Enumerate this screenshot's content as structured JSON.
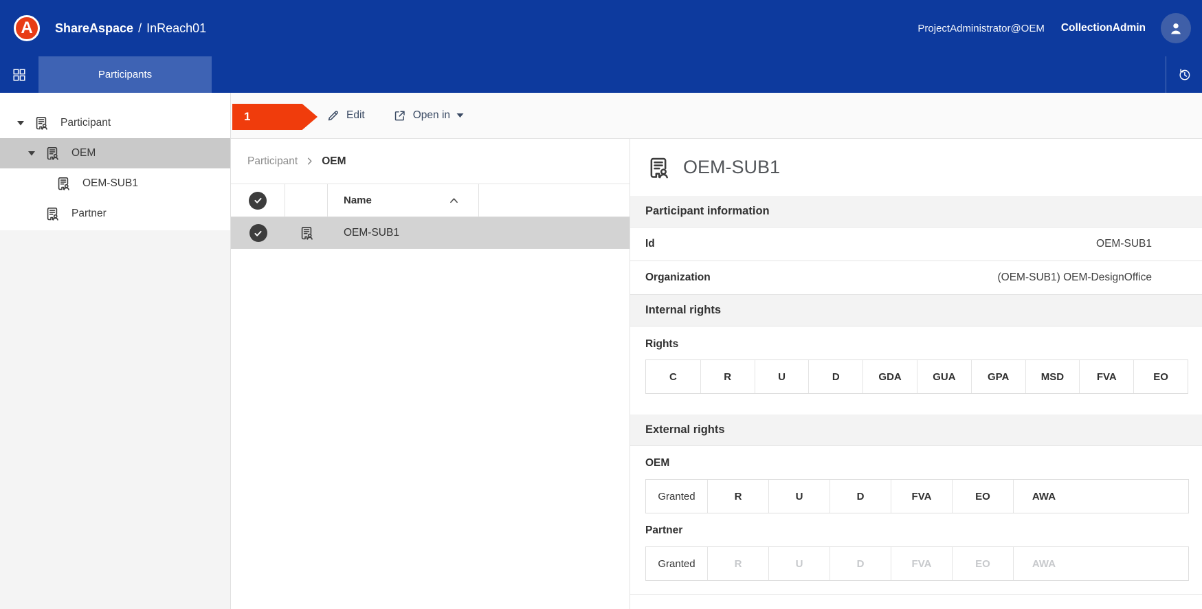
{
  "header": {
    "logo_letter": "A",
    "brand": "ShareAspace",
    "divider": "/",
    "workspace": "InReach01",
    "user": "ProjectAdministrator@OEM",
    "role": "CollectionAdmin"
  },
  "nav": {
    "active_tab": "Participants"
  },
  "sidebar": {
    "items": [
      {
        "label": "Participant",
        "level": 0,
        "expanded": true,
        "selected": false
      },
      {
        "label": "OEM",
        "level": 1,
        "expanded": true,
        "selected": true
      },
      {
        "label": "OEM-SUB1",
        "level": 2,
        "expanded": false,
        "selected": false
      },
      {
        "label": "Partner",
        "level": 1,
        "expanded": false,
        "selected": false
      }
    ]
  },
  "toolbar": {
    "annotation": "1",
    "edit": "Edit",
    "open_in": "Open in"
  },
  "list": {
    "breadcrumb": {
      "parent": "Participant",
      "current": "OEM"
    },
    "columns": {
      "name": "Name",
      "sort": "ascending"
    },
    "rows": [
      {
        "name": "OEM-SUB1",
        "selected": true
      }
    ]
  },
  "details": {
    "title": "OEM-SUB1",
    "info_section": "Participant information",
    "fields": [
      {
        "label": "Id",
        "value": "OEM-SUB1"
      },
      {
        "label": "Organization",
        "value": "(OEM-SUB1) OEM-DesignOffice"
      }
    ],
    "internal_section": "Internal rights",
    "rights_label": "Rights",
    "internal_cells": [
      "C",
      "R",
      "U",
      "D",
      "GDA",
      "GUA",
      "GPA",
      "MSD",
      "FVA",
      "EO"
    ],
    "external_section": "External rights",
    "groups": [
      {
        "label": "OEM",
        "granted": "Granted",
        "cells": [
          "R",
          "U",
          "D",
          "FVA",
          "EO",
          "AWA"
        ],
        "enabled": true
      },
      {
        "label": "Partner",
        "granted": "Granted",
        "cells": [
          "R",
          "U",
          "D",
          "FVA",
          "EO",
          "AWA"
        ],
        "enabled": false
      }
    ]
  },
  "colors": {
    "header_blue": "#0d3a9e",
    "tab_blue": "#3e63b4",
    "accent_red": "#f03c0c",
    "row_selected_gray": "#d3d3d3",
    "tree_selected_gray": "#c9c9c9",
    "section_band_gray": "#f3f3f3"
  }
}
